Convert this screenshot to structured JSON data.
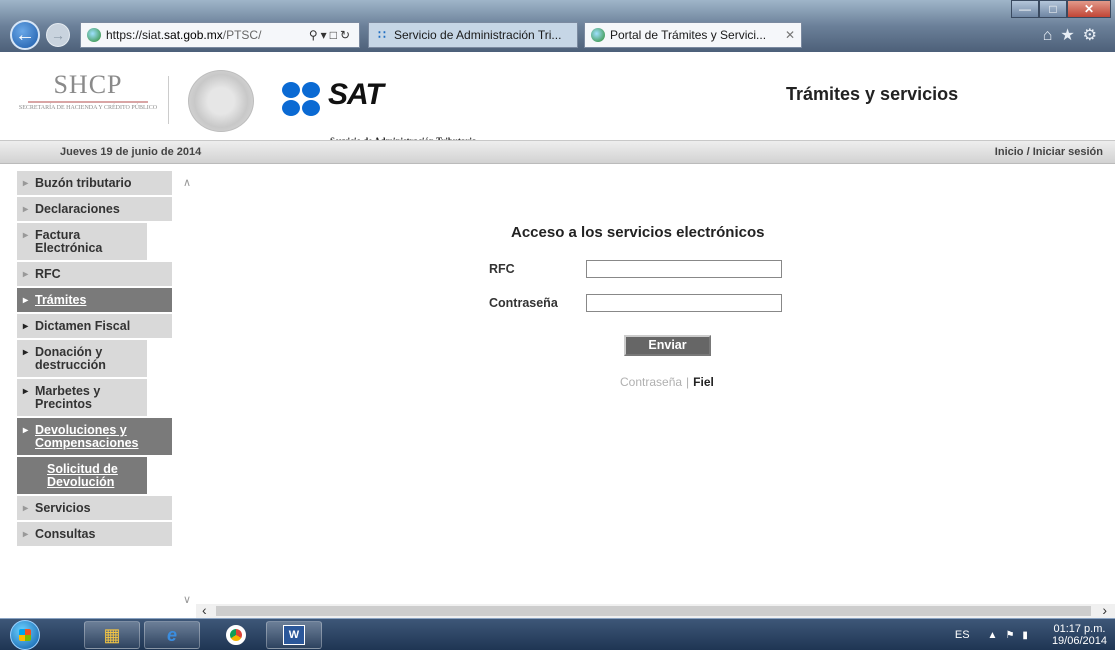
{
  "browser": {
    "address_host_prefix": "https://siat.",
    "address_host_bold": "sat.gob.mx",
    "address_path": "/PTSC/",
    "tab_1_title": "Servicio de Administración Tri...",
    "tab_2_title": "Portal de Trámites y Servici..."
  },
  "header": {
    "shcp_logo": "SHCP",
    "shcp_subtitle": "SECRETARÍA DE HACIENDA Y CRÉDITO PÚBLICO",
    "sat_logo": "SAT",
    "sat_subtitle": "Servicio de Administración Tributaria",
    "page_heading": "Trámites y servicios"
  },
  "topbar": {
    "date": "Jueves 19 de junio de 2014",
    "login_link": "Inicio / Iniciar sesión"
  },
  "sidebar": {
    "items": [
      {
        "label": "Buzón tributario"
      },
      {
        "label": "Declaraciones"
      },
      {
        "label": "Factura Electrónica"
      },
      {
        "label": "RFC"
      },
      {
        "label": "Trámites"
      },
      {
        "label": "Dictamen Fiscal"
      },
      {
        "label": "Donación y destrucción"
      },
      {
        "label": "Marbetes y Precintos"
      },
      {
        "label": "Devoluciones y Compensaciones"
      },
      {
        "label": "Solicitud de Devolución"
      },
      {
        "label": "Servicios"
      },
      {
        "label": "Consultas"
      }
    ]
  },
  "login": {
    "title": "Acceso a los servicios electrónicos",
    "rfc_label": "RFC",
    "rfc_value": "",
    "password_label": "Contraseña",
    "password_value": "",
    "submit_label": "Enviar",
    "link_password": "Contraseña",
    "link_separator": "|",
    "link_fiel": "Fiel"
  },
  "taskbar": {
    "language": "ES",
    "time": "01:17 p.m.",
    "date": "19/06/2014"
  }
}
